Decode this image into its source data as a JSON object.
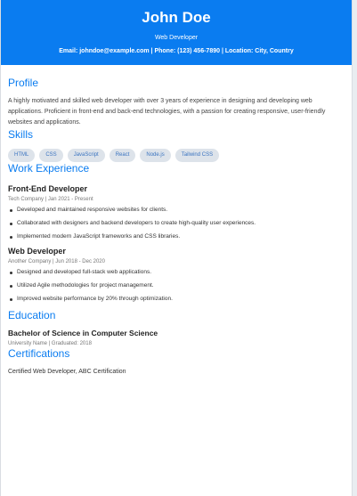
{
  "header": {
    "name": "John Doe",
    "role": "Web Developer",
    "contact": "Email: johndoe@example.com | Phone: (123) 456-7890 | Location: City, Country"
  },
  "profile": {
    "title": "Profile",
    "text": "A highly motivated and skilled web developer with over 3 years of experience in designing and developing web applications. Proficient in front-end and back-end technologies, with a passion for creating responsive, user-friendly websites and applications."
  },
  "skills": {
    "title": "Skills",
    "items": [
      "HTML",
      "CSS",
      "JavaScript",
      "React",
      "Node.js",
      "Tailwind CSS"
    ]
  },
  "work": {
    "title": "Work Experience",
    "jobs": [
      {
        "title": "Front-End Developer",
        "meta": "Tech Company | Jan 2021 - Present",
        "bullets": [
          "Developed and maintained responsive websites for clients.",
          "Collaborated with designers and backend developers to create high-quality user experiences.",
          "Implemented modern JavaScript frameworks and CSS libraries."
        ]
      },
      {
        "title": "Web Developer",
        "meta": "Another Company | Jun 2018 - Dec 2020",
        "bullets": [
          "Designed and developed full-stack web applications.",
          "Utilized Agile methodologies for project management.",
          "Improved website performance by 20% through optimization."
        ]
      }
    ]
  },
  "education": {
    "title": "Education",
    "degree": "Bachelor of Science in Computer Science",
    "meta": "University Name | Graduated: 2018"
  },
  "certifications": {
    "title": "Certifications",
    "text": "Certified Web Developer, ABC Certification"
  },
  "colors": {
    "accent": "#0a7cf0",
    "skill_bg": "#dde3ea",
    "skill_text": "#3b74c0"
  }
}
